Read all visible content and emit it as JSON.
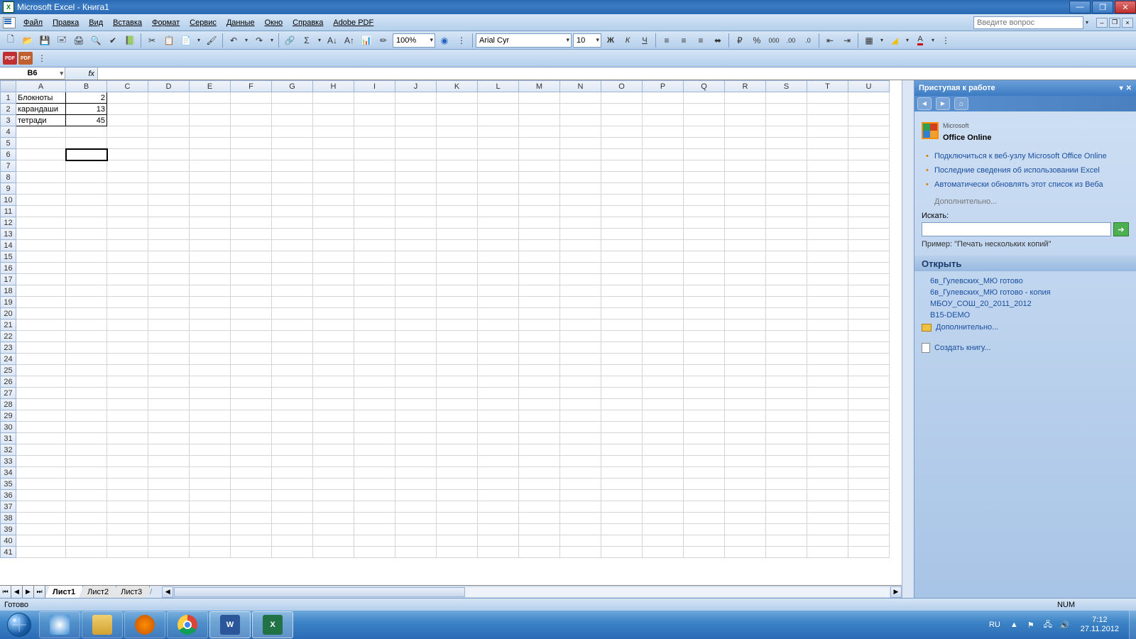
{
  "title": "Microsoft Excel - Книга1",
  "menus": [
    "Файл",
    "Правка",
    "Вид",
    "Вставка",
    "Формат",
    "Сервис",
    "Данные",
    "Окно",
    "Справка",
    "Adobe PDF"
  ],
  "help_placeholder": "Введите вопрос",
  "toolbar": {
    "zoom": "100%",
    "font": "Arial Cyr",
    "font_size": "10"
  },
  "name_box": "B6",
  "fx_label": "fx",
  "columns": [
    "A",
    "B",
    "C",
    "D",
    "E",
    "F",
    "G",
    "H",
    "I",
    "J",
    "K",
    "L",
    "M",
    "N",
    "O",
    "P",
    "Q",
    "R",
    "S",
    "T",
    "U"
  ],
  "row_count": 41,
  "cells": {
    "A1": "Блокноты",
    "B1": "2",
    "A2": "карандаши",
    "B2": "13",
    "A3": "тетради",
    "B3": "45"
  },
  "selected_cell": "B6",
  "sheets": [
    "Лист1",
    "Лист2",
    "Лист3"
  ],
  "active_sheet": 0,
  "status": {
    "ready": "Готово",
    "num": "NUM"
  },
  "taskpane": {
    "title": "Приступая к работе",
    "office_online": "Office Online",
    "office_prefix": "Microsoft",
    "links": [
      "Подключиться к веб-узлу Microsoft Office Online",
      "Последние сведения об использовании Excel",
      "Автоматически обновлять этот список из Веба"
    ],
    "more": "Дополнительно...",
    "search_label": "Искать:",
    "example_label": "Пример:",
    "example_text": "\"Печать нескольких копий\"",
    "open_header": "Открыть",
    "recent_files": [
      "6в_Гулевских_МЮ готово",
      "6в_Гулевских_МЮ готово - копия",
      "МБОУ_СОШ_20_2011_2012",
      "B15-DEMO"
    ],
    "more_files": "Дополнительно...",
    "create_new": "Создать книгу..."
  },
  "taskbar": {
    "lang": "RU",
    "time": "7:12",
    "date": "27.11.2012"
  }
}
